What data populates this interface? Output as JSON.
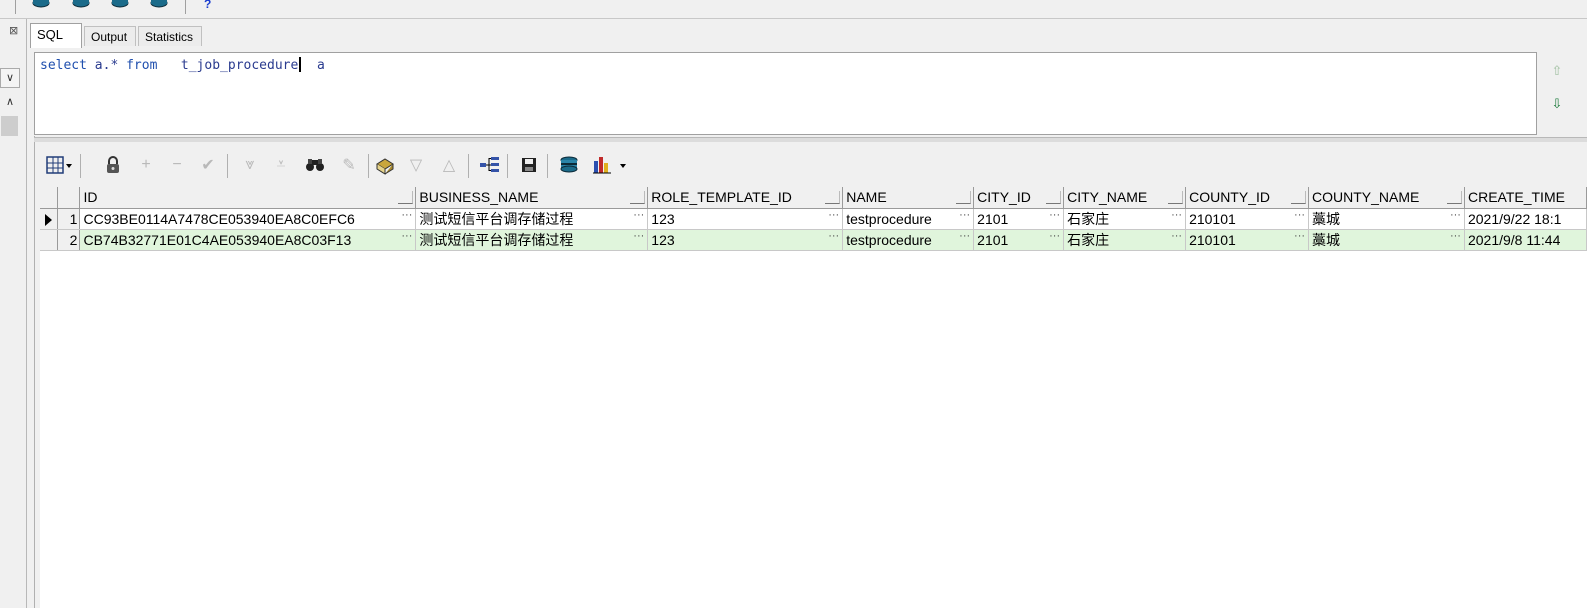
{
  "tabs": [
    {
      "label": "SQL",
      "active": true
    },
    {
      "label": "Output",
      "active": false
    },
    {
      "label": "Statistics",
      "active": false
    }
  ],
  "top_toolbar": {
    "icons": [
      "database-icon",
      "database-icon",
      "database-icon",
      "database-icon"
    ],
    "help_label": "?"
  },
  "editor": {
    "kw_select": "select",
    "text_a": " a.* ",
    "kw_from": "from",
    "table_name": "   t_job_procedure",
    "alias": "  a"
  },
  "grid_toolbar": {
    "icons": [
      "grid-options-icon",
      "lock-icon",
      "add-record-icon",
      "delete-record-icon",
      "post-changes-icon",
      "fetch-next-icon",
      "fetch-last-icon",
      "find-icon",
      "clear-record-icon",
      "query-by-example-icon",
      "previous-record-icon",
      "next-record-icon",
      "explain-plan-icon",
      "save-icon",
      "export-icon",
      "chart-icon"
    ]
  },
  "grid": {
    "columns": [
      "ID",
      "BUSINESS_NAME",
      "ROLE_TEMPLATE_ID",
      "NAME",
      "CITY_ID",
      "CITY_NAME",
      "COUNTY_ID",
      "COUNTY_NAME",
      "CREATE_TIME"
    ],
    "rows": [
      {
        "num": "1",
        "cells": [
          "CC93BE0114A7478CE053940EA8C0EFC6",
          "测试短信平台调存储过程",
          "123",
          "testprocedure",
          "2101",
          "石家庄",
          "210101",
          "藁城",
          "2021/9/22 18:1"
        ]
      },
      {
        "num": "2",
        "cells": [
          "CB74B32771E01C4AE053940EA8C03F13",
          "测试短信平台调存储过程",
          "123",
          "testprocedure",
          "2101",
          "石家庄",
          "210101",
          "藁城",
          "2021/9/8 11:44"
        ]
      }
    ]
  },
  "colors": {
    "selected_row_bg": "#e0f5dc",
    "keyword": "#1f4fae"
  }
}
